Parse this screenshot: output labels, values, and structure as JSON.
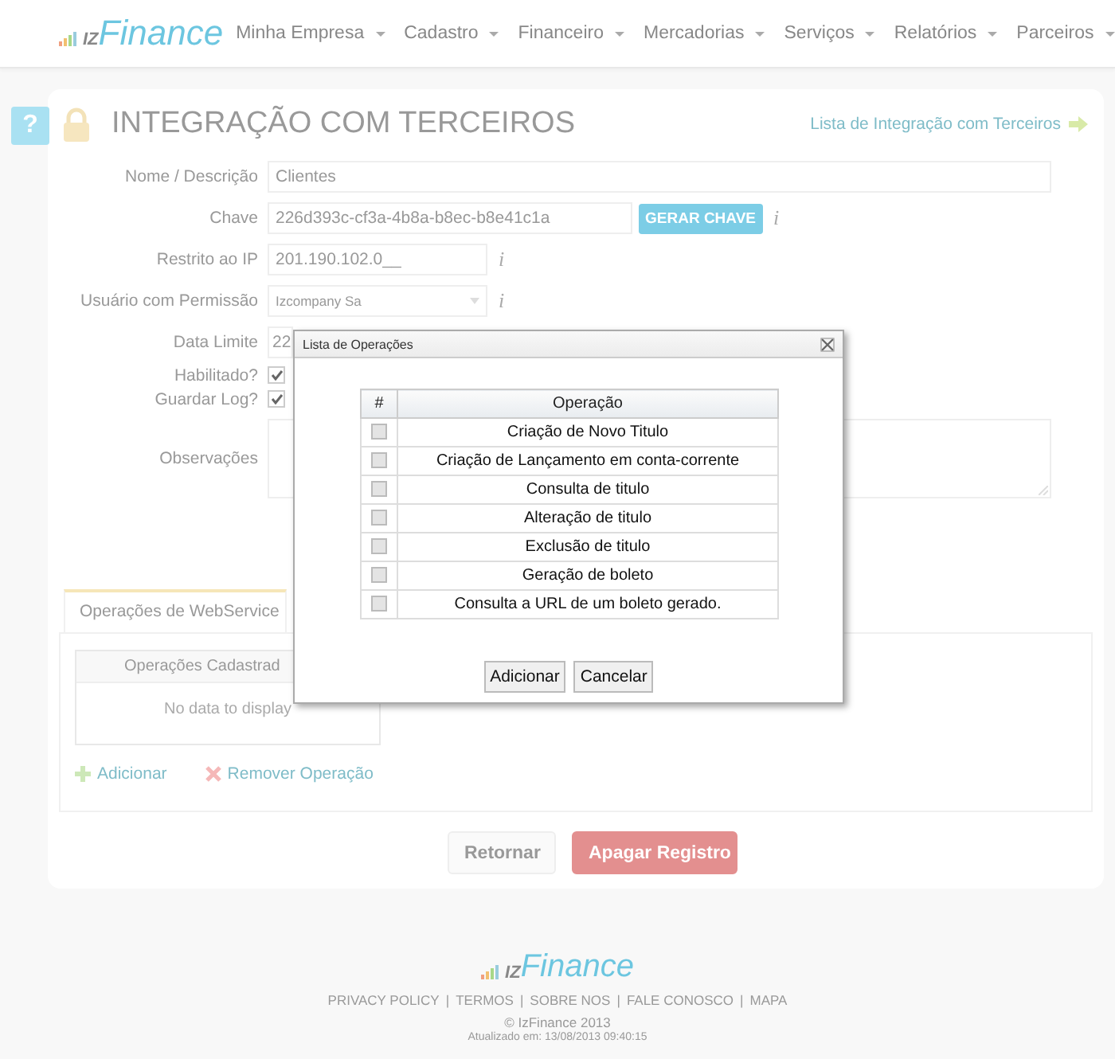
{
  "header": {
    "logo": {
      "prefix": "IZ",
      "name": "Finance"
    },
    "menu": [
      {
        "label": "Minha Empresa"
      },
      {
        "label": "Cadastro"
      },
      {
        "label": "Financeiro"
      },
      {
        "label": "Mercadorias"
      },
      {
        "label": "Serviços"
      },
      {
        "label": "Relatórios"
      },
      {
        "label": "Parceiros"
      }
    ]
  },
  "page": {
    "help": "?",
    "title": "INTEGRAÇÃO COM TERCEIROS",
    "list_link": "Lista de Integração com Terceiros"
  },
  "form": {
    "fields": [
      {
        "kind": "text",
        "label": "Nome / Descrição",
        "value": "Clientes"
      },
      {
        "kind": "text",
        "label": "Chave",
        "value": "226d393c-cf3a-4b8a-b8ec-b8e41c1a",
        "button": "GERAR CHAVE",
        "info": "i"
      },
      {
        "kind": "text",
        "label": "Restrito ao IP",
        "value": "201.190.102.0__",
        "info": "i"
      },
      {
        "kind": "select",
        "label": "Usuário com Permissão",
        "value": "Izcompany Sa",
        "info": "i"
      },
      {
        "kind": "text",
        "label": "Data Limite",
        "value": "22"
      },
      {
        "kind": "checkbox",
        "label": "Habilitado?",
        "checked": true
      },
      {
        "kind": "checkbox",
        "label": "Guardar Log?",
        "checked": true
      },
      {
        "kind": "textarea",
        "label": "Observações"
      }
    ]
  },
  "tabs": [
    {
      "label": "Operações de WebService",
      "selected": true
    }
  ],
  "grid": {
    "column": "Operações Cadastrad",
    "empty": "No data to display"
  },
  "actions": [
    {
      "kind": "add",
      "label": "Adicionar"
    },
    {
      "kind": "remove",
      "label": "Remover Operação"
    }
  ],
  "buttons": [
    {
      "kind": "default",
      "label": "Retornar"
    },
    {
      "kind": "danger",
      "label": "Apagar Registro"
    }
  ],
  "modal": {
    "title": "Lista de Operações",
    "columns": [
      "#",
      "Operação"
    ],
    "rows": [
      {
        "operation": "Criação de Novo Titulo",
        "checked": false
      },
      {
        "operation": "Criação de Lançamento em conta-corrente",
        "checked": false
      },
      {
        "operation": "Consulta de titulo",
        "checked": false
      },
      {
        "operation": "Alteração de titulo",
        "checked": false
      },
      {
        "operation": "Exclusão de titulo",
        "checked": false
      },
      {
        "operation": "Geração de boleto",
        "checked": false
      },
      {
        "operation": "Consulta a URL de um boleto gerado.",
        "checked": false
      }
    ],
    "buttons": [
      "Adicionar",
      "Cancelar"
    ]
  },
  "footer": {
    "logo": {
      "prefix": "IZ",
      "name": "Finance"
    },
    "links": [
      "PRIVACY POLICY",
      "TERMOS",
      "SOBRE NOS",
      "FALE CONOSCO",
      "MAPA"
    ],
    "separator": "|",
    "copyright": "© IzFinance 2013",
    "updated": "Atualizado em: 13/08/2013 09:40:15"
  }
}
